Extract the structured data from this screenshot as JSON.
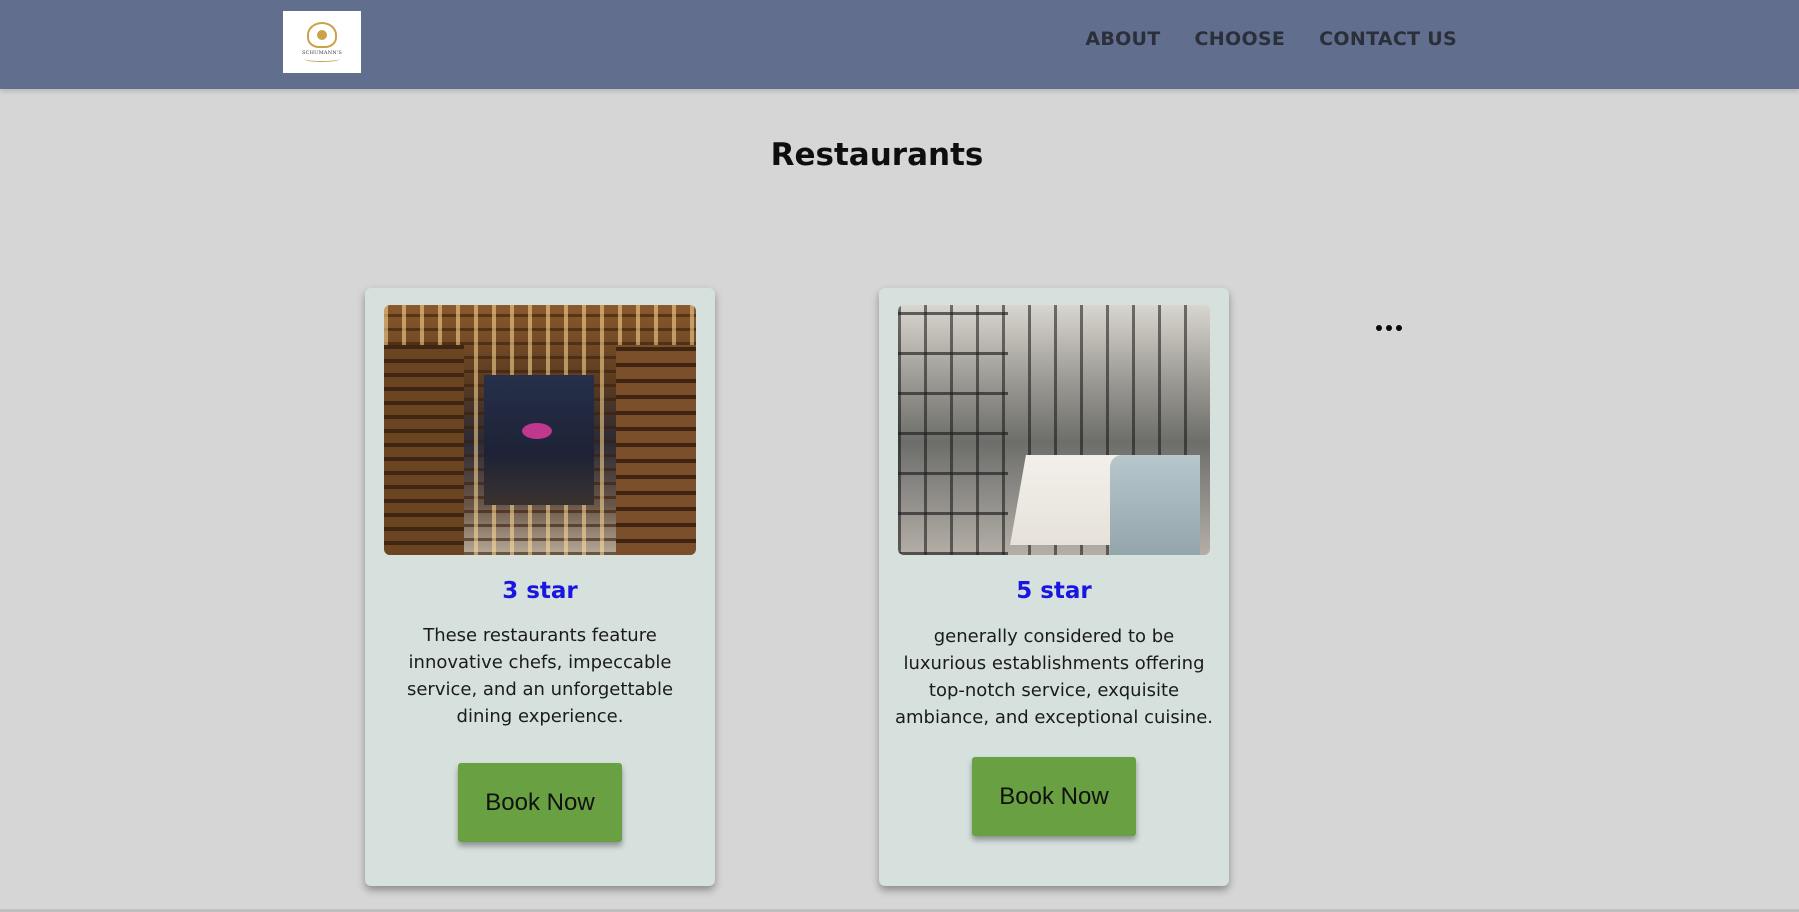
{
  "header": {
    "logo_text": "SCHUMANN'S",
    "nav": [
      {
        "label": "ABOUT"
      },
      {
        "label": "CHOOSE"
      },
      {
        "label": "CONTACT US"
      }
    ]
  },
  "main": {
    "title": "Restaurants",
    "cards": [
      {
        "title": "3 star",
        "description": "These restaurants feature innovative chefs, impeccable service, and an unforgettable dining experience.",
        "button_label": "Book Now"
      },
      {
        "title": "5 star",
        "description": "generally considered to be luxurious establishments offering top-notch service, exquisite ambiance, and exceptional cuisine.",
        "button_label": "Book Now"
      }
    ],
    "more_icon": "more-horizontal-icon"
  },
  "colors": {
    "header_bg": "#626e8e",
    "page_bg": "#d6d6d6",
    "card_bg": "#d6e0dd",
    "card_title": "#1a16e2",
    "button_bg": "#68a042"
  }
}
